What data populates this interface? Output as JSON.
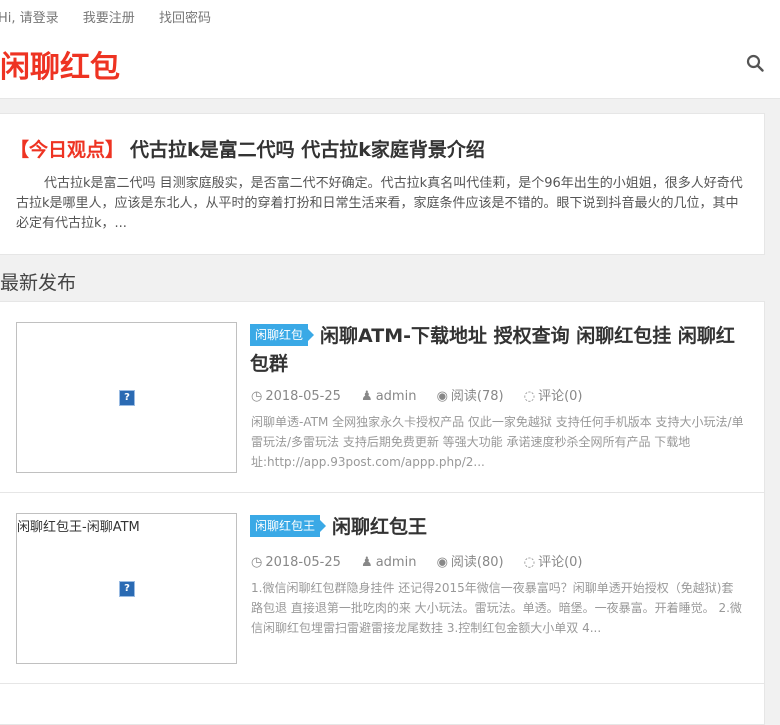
{
  "header": {
    "greeting": "Hi, 请登录",
    "register": "我要注册",
    "recover": "找回密码",
    "site_title": "闲聊红包"
  },
  "featured": {
    "tag": "【今日观点】",
    "title": "代古拉k是富二代吗 代古拉k家庭背景介绍",
    "excerpt": "代古拉k是富二代吗 目测家庭殷实，是否富二代不好确定。代古拉k真名叫代佳莉，是个96年出生的小姐姐，很多人好奇代古拉k是哪里人，应该是东北人，从平时的穿着打扮和日常生活来看，家庭条件应该是不错的。眼下说到抖音最火的几位，其中必定有代古拉k，..."
  },
  "section_heading": "最新发布",
  "posts": [
    {
      "thumb_alt": "",
      "category": "闲聊红包",
      "title": "闲聊ATM-下载地址 授权查询 闲聊红包挂 闲聊红包群",
      "date": "2018-05-25",
      "author": "admin",
      "views": "阅读(78)",
      "comments": "评论(0)",
      "excerpt": "闲聊单透-ATM 全网独家永久卡授权产品 仅此一家免越狱 支持任何手机版本 支持大小玩法/单雷玩法/多雷玩法 支持后期免费更新 等强大功能 承诺速度秒杀全网所有产品 下载地址:http://app.93post.com/appp.php/2..."
    },
    {
      "thumb_alt": "闲聊红包王-闲聊ATM",
      "category": "闲聊红包王",
      "title": "闲聊红包王",
      "date": "2018-05-25",
      "author": "admin",
      "views": "阅读(80)",
      "comments": "评论(0)",
      "excerpt": "1.微信闲聊红包群隐身挂件 还记得2015年微信一夜暴富吗？闲聊单透开始授权（免越狱)套路包退 直接退第一批吃肉的来 大小玩法。雷玩法。单透。暗堡。一夜暴富。开着睡觉。 2.微信闲聊红包埋雷扫雷避雷接龙尾数挂 3.控制红包金额大小单双 4..."
    }
  ],
  "icons": {
    "search": "search-icon",
    "clock": "clock-icon",
    "user": "user-icon",
    "eye": "eye-icon",
    "comment": "comment-icon",
    "broken_image": "broken-image-icon"
  },
  "colors": {
    "brand": "#ee3322",
    "category": "#3aa9e6"
  }
}
